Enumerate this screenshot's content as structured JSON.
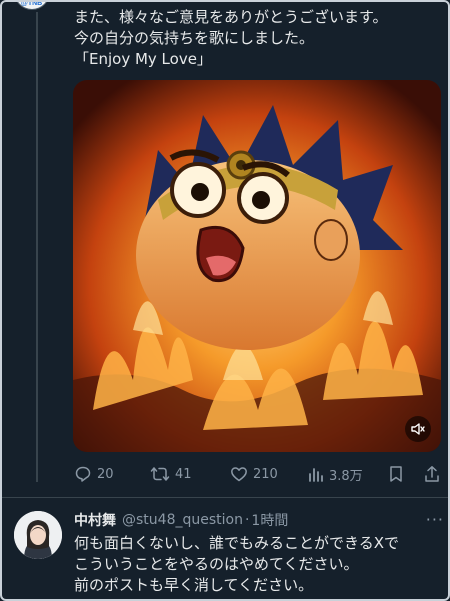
{
  "tweet": {
    "avatar_label": "@TNB",
    "lines": [
      "また、様々なご意見をありがとうございます。",
      "今の自分の気持ちを歌にしました。",
      "「Enjoy My Love」"
    ],
    "media_icon": "flaming-cartoon-head-image",
    "mute_icon": "speaker-muted-icon"
  },
  "actions": {
    "replies": "20",
    "reposts": "41",
    "likes": "210",
    "views": "3.8万",
    "icons": [
      "reply-icon",
      "repost-icon",
      "like-icon",
      "views-icon",
      "bookmark-icon",
      "share-icon"
    ]
  },
  "reply": {
    "name": "中村舞",
    "handle": "@stu48_question",
    "separator": "·",
    "time": "1時間",
    "more": "···",
    "lines": [
      "何も面白くないし、誰でもみることができるXで",
      "こういうことをやるのはやめてください。",
      "前のポストも早く消してください。"
    ]
  },
  "colors": {
    "background": "#15202b",
    "text": "#e7e9ea",
    "muted": "#8b98a5",
    "divider": "#38444d"
  }
}
